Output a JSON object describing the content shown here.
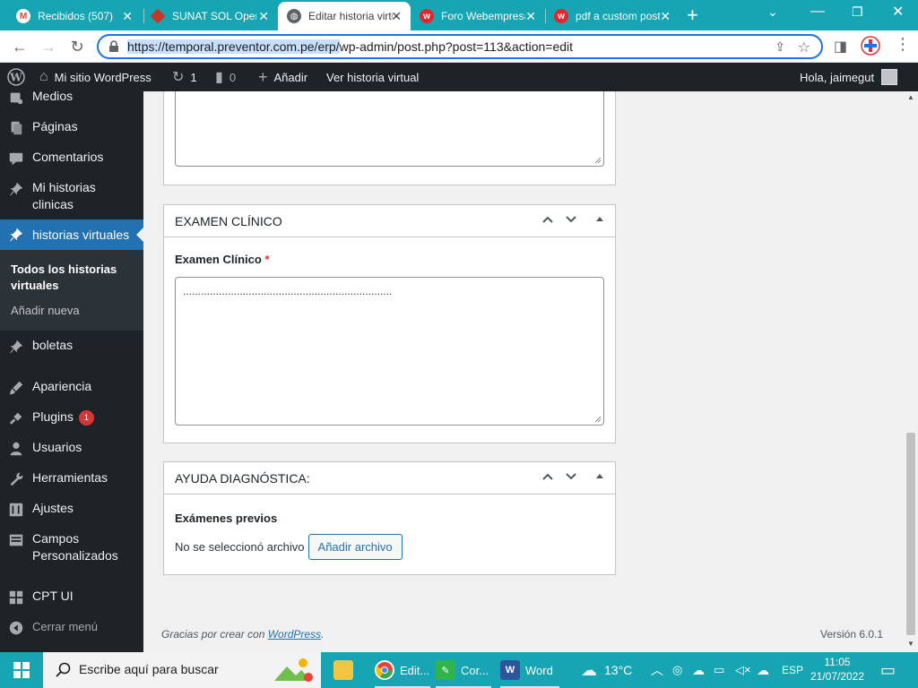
{
  "browser": {
    "tabs": [
      {
        "title": "Recibidos (507)",
        "active": false
      },
      {
        "title": "SUNAT SOL Operaciones",
        "active": false
      },
      {
        "title": "Editar historia virtual",
        "active": true
      },
      {
        "title": "Foro Webempresa",
        "active": false
      },
      {
        "title": "pdf a custom post",
        "active": false
      }
    ],
    "url_selected": "https://temporal.preventor.com.pe/erp/",
    "url_rest": "wp-admin/post.php?post=113&action=edit"
  },
  "adminbar": {
    "site_name": "Mi sitio WordPress",
    "updates_count": "1",
    "comments_count": "0",
    "add_new": "Añadir",
    "view_post": "Ver historia virtual",
    "greeting": "Hola, jaimegut"
  },
  "sidebar": {
    "items": {
      "media": "Medios",
      "pages": "Páginas",
      "comments": "Comentarios",
      "my_histories_1": "Mi historias",
      "my_histories_2": "clinicas",
      "virtual_histories": "historias virtuales",
      "boletas": "boletas",
      "appearance": "Apariencia",
      "plugins": "Plugins",
      "plugins_badge": "1",
      "users": "Usuarios",
      "tools": "Herramientas",
      "settings": "Ajustes",
      "custom_fields_1": "Campos",
      "custom_fields_2": "Personalizados",
      "cpt_ui": "CPT UI",
      "collapse": "Cerrar menú"
    },
    "submenu": {
      "all_1": "Todos los historias",
      "all_2": "virtuales",
      "add_new": "Añadir nueva"
    }
  },
  "content": {
    "examen_box": {
      "title": "EXAMEN CLÍNICO",
      "field_label": "Examen Clínico",
      "required_mark": "*",
      "textarea_value": "......................................................................"
    },
    "ayuda_box": {
      "title": "AYUDA DIAGNÓSTICA:",
      "field_label": "Exámenes previos",
      "no_file": "No se seleccionó archivo",
      "add_file_button": "Añadir archivo"
    },
    "footer": {
      "thanks_prefix": "Gracias por crear con ",
      "thanks_link": "WordPress",
      "thanks_suffix": ".",
      "version": "Versión 6.0.1"
    }
  },
  "taskbar": {
    "search_placeholder": "Escribe aquí para buscar",
    "apps": [
      {
        "label": "Edit..."
      },
      {
        "label": "Cor..."
      },
      {
        "label": "Word"
      }
    ],
    "weather": "13°C",
    "language": "ESP",
    "time": "11:05",
    "date": "21/07/2022"
  },
  "colors": {
    "accent": "#17a4b3",
    "wp_dark": "#1d2327",
    "wp_blue": "#2271b1",
    "required": "#d63638"
  }
}
